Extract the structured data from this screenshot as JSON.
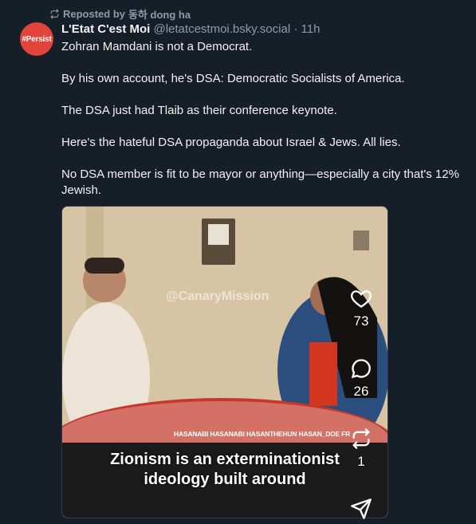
{
  "repost": {
    "label": "Reposted by",
    "user": "동하 dong ha"
  },
  "author": {
    "avatar_text": "#Persist",
    "name": "L'Etat C'est Moi",
    "handle": "@letatcestmoi.bsky.social",
    "separator": "·",
    "time": "11h"
  },
  "post": {
    "paragraphs": [
      "Zohran Mamdani is not a Democrat.",
      "By his own account, he's DSA: Democratic Socialists of America.",
      "The DSA just had Tlaib as their conference keynote.",
      "Here's the hateful DSA propaganda about Israel & Jews. All lies.",
      "No DSA member is fit to be mayor or anything—especially a city that's 12% Jewish."
    ]
  },
  "video": {
    "watermark": "@CanaryMission",
    "tag_strip": "HASANABI  HASANABI  HASANTHEHUN  HASAN_DOE  FR",
    "caption_line1": "Zionism is an exterminationist",
    "caption_line2": "ideology built around"
  },
  "actions": {
    "likes": "73",
    "comments": "26",
    "reposts": "1"
  },
  "colors": {
    "background": "#161e27",
    "muted": "#8d9bab",
    "avatar": "#e0443a"
  }
}
